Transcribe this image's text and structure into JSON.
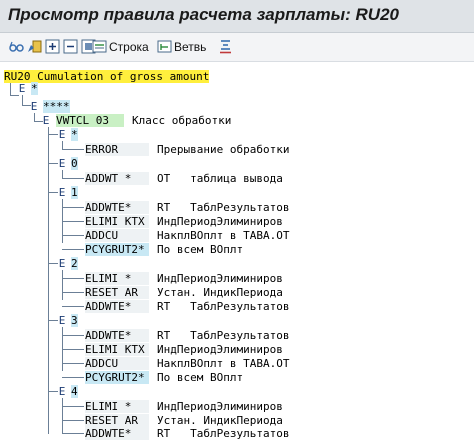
{
  "window": {
    "title": "Просмотр правила расчета зарплаты: RU20"
  },
  "toolbar": {
    "row_label": "Строка",
    "branch_label": "Ветвь"
  },
  "tree": {
    "root": {
      "key": "RU20",
      "text": "Cumulation of gross amount"
    },
    "level1": "*",
    "level2": "****",
    "op1": {
      "key": "VWTCL 03",
      "text": "Класс обработки"
    },
    "group_star": "*",
    "error_row": {
      "key": "ERROR",
      "text": "Прерывание обработки"
    },
    "group0": "0",
    "addwt_row": {
      "key": "ADDWT *",
      "text": "ОТ   таблица вывода"
    },
    "group1": "1",
    "g1_rows": [
      {
        "key": "ADDWTE*",
        "text": "RT   ТаблРезультатов"
      },
      {
        "key": "ELIMI KTX",
        "text": "ИндПериодЭлиминиров"
      },
      {
        "key": "ADDCU",
        "text": "НакплВОплт в ТАВА.ОТ"
      },
      {
        "key": "PCYGRUT2*",
        "text": "По всем ВОплт"
      }
    ],
    "group2": "2",
    "g2_rows": [
      {
        "key": "ELIMI *",
        "text": "ИндПериодЭлиминиров"
      },
      {
        "key": "RESET AR",
        "text": "Устан. ИндикПериода"
      },
      {
        "key": "ADDWTE*",
        "text": "RT   ТаблРезультатов"
      }
    ],
    "group3": "3",
    "g3_rows": [
      {
        "key": "ADDWTE*",
        "text": "RT   ТаблРезультатов"
      },
      {
        "key": "ELIMI KTX",
        "text": "ИндПериодЭлиминиров"
      },
      {
        "key": "ADDCU",
        "text": "НакплВОплт в ТАВА.ОТ"
      },
      {
        "key": "PCYGRUT2*",
        "text": "По всем ВОплт"
      }
    ],
    "group4": "4",
    "g4_rows": [
      {
        "key": "ELIMI *",
        "text": "ИндПериодЭлиминиров"
      },
      {
        "key": "RESET AR",
        "text": "Устан. ИндикПериода"
      },
      {
        "key": "ADDWTE*",
        "text": "RT   ТаблРезультатов"
      }
    ]
  }
}
